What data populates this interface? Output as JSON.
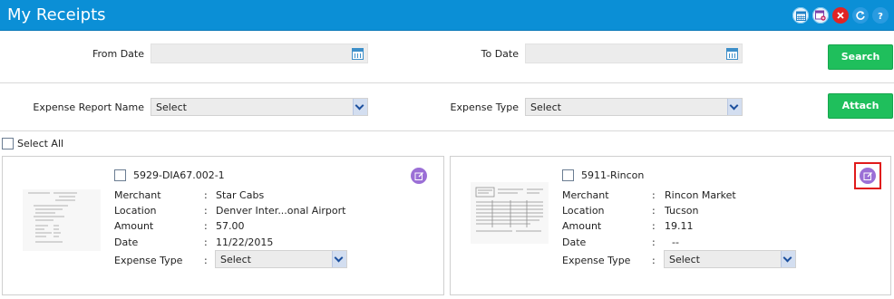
{
  "header": {
    "title": "My Receipts",
    "icons": [
      "calendar-grid-icon",
      "calendar-add-icon",
      "close-icon",
      "refresh-icon",
      "help-icon"
    ]
  },
  "filters": {
    "from_date_label": "From Date",
    "to_date_label": "To Date",
    "search_label": "Search",
    "expense_report_label": "Expense Report Name",
    "expense_report_value": "Select",
    "expense_type_label": "Expense Type",
    "expense_type_value": "Select",
    "attach_label": "Attach",
    "select_all_label": "Select All"
  },
  "fields": {
    "merchant": "Merchant",
    "location": "Location",
    "amount": "Amount",
    "date": "Date",
    "expense_type": "Expense Type",
    "sep": ":"
  },
  "receipts": [
    {
      "id": "5929-DIA67.002-1",
      "merchant": "Star Cabs",
      "location": "Denver Inter...onal Airport",
      "amount": "57.00",
      "date": "11/22/2015",
      "expense_type": "Select"
    },
    {
      "id": "5911-Rincon",
      "merchant": "Rincon Market",
      "location": "Tucson",
      "amount": "19.11",
      "date": "--",
      "expense_type": "Select"
    }
  ],
  "colors": {
    "header_bg": "#0b8fd6",
    "button_green": "#1fbf5c",
    "edit_purple": "#9b6fd6",
    "highlight_red": "#e01b1b"
  }
}
